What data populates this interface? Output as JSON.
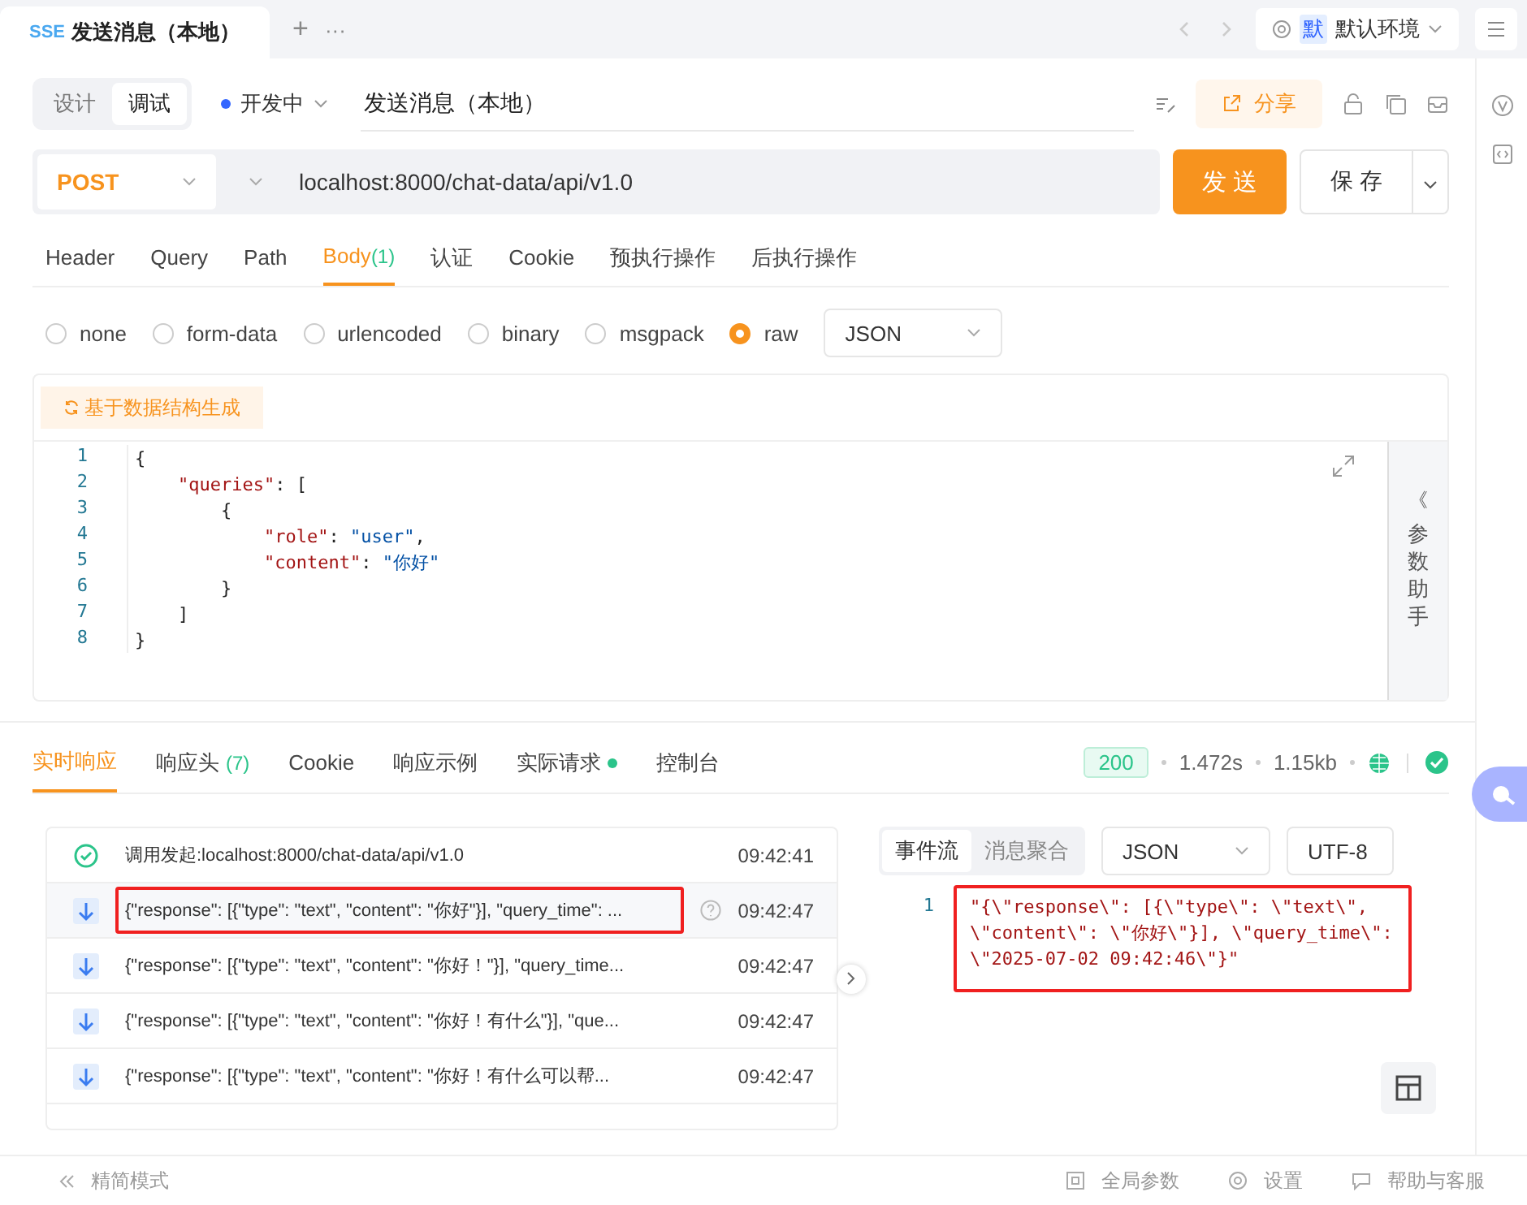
{
  "tab_bar": {
    "tabs": [
      {
        "badge": "SSE",
        "label": "发送消息（本地）",
        "selected": true
      }
    ],
    "add": "+",
    "more": "···",
    "environment": {
      "badge": "默",
      "label": "默认环境"
    }
  },
  "toolbar": {
    "modes": [
      {
        "label": "设计",
        "selected": false
      },
      {
        "label": "调试",
        "selected": true
      }
    ],
    "status": {
      "label": "开发中",
      "color": "#3366ff"
    },
    "name": "发送消息（本地）",
    "share": "分享"
  },
  "request": {
    "method": "POST",
    "url": "localhost:8000/chat-data/api/v1.0",
    "send": "发 送",
    "save": "保 存"
  },
  "param_tabs": [
    {
      "label": "Header",
      "selected": false
    },
    {
      "label": "Query",
      "selected": false
    },
    {
      "label": "Path",
      "selected": false
    },
    {
      "label": "Body",
      "count": "(1)",
      "selected": true
    },
    {
      "label": "认证",
      "selected": false
    },
    {
      "label": "Cookie",
      "selected": false
    },
    {
      "label": "预执行操作",
      "selected": false
    },
    {
      "label": "后执行操作",
      "selected": false
    }
  ],
  "body_types": [
    {
      "label": "none",
      "selected": false
    },
    {
      "label": "form-data",
      "selected": false
    },
    {
      "label": "urlencoded",
      "selected": false
    },
    {
      "label": "binary",
      "selected": false
    },
    {
      "label": "msgpack",
      "selected": false
    },
    {
      "label": "raw",
      "selected": true
    }
  ],
  "body_format": "JSON",
  "generate_button": "基于数据结构生成",
  "editor": {
    "lines": [
      {
        "number": "1",
        "tokens": [
          {
            "kind": "punct",
            "text": "{"
          }
        ]
      },
      {
        "number": "2",
        "tokens": [
          {
            "kind": "key",
            "text": "    \"queries\""
          },
          {
            "kind": "punct",
            "text": ": ["
          }
        ]
      },
      {
        "number": "3",
        "tokens": [
          {
            "kind": "punct",
            "text": "        {"
          }
        ]
      },
      {
        "number": "4",
        "tokens": [
          {
            "kind": "key",
            "text": "            \"role\""
          },
          {
            "kind": "punct",
            "text": ": "
          },
          {
            "kind": "str",
            "text": "\"user\""
          },
          {
            "kind": "punct",
            "text": ","
          }
        ]
      },
      {
        "number": "5",
        "tokens": [
          {
            "kind": "key",
            "text": "            \"content\""
          },
          {
            "kind": "punct",
            "text": ": "
          },
          {
            "kind": "str",
            "text": "\"你好\""
          }
        ]
      },
      {
        "number": "6",
        "tokens": [
          {
            "kind": "punct",
            "text": "        }"
          }
        ]
      },
      {
        "number": "7",
        "tokens": [
          {
            "kind": "punct",
            "text": "    ]"
          }
        ]
      },
      {
        "number": "8",
        "tokens": [
          {
            "kind": "punct",
            "text": "}"
          }
        ]
      }
    ]
  },
  "helper": {
    "icon": "《",
    "label": "参数助手"
  },
  "response": {
    "tabs": [
      {
        "label": "实时响应",
        "selected": true
      },
      {
        "label": "响应头",
        "count": "(7)",
        "selected": false
      },
      {
        "label": "Cookie",
        "selected": false
      },
      {
        "label": "响应示例",
        "selected": false
      },
      {
        "label": "实际请求",
        "dot": true,
        "selected": false
      },
      {
        "label": "控制台",
        "selected": false
      }
    ],
    "status_code": "200",
    "time": "1.472s",
    "size": "1.15kb"
  },
  "events": [
    {
      "kind": "start",
      "text": "调用发起:localhost:8000/chat-data/api/v1.0",
      "time": "09:42:41",
      "selected": false,
      "highlighted": false
    },
    {
      "kind": "message",
      "text": "{\"response\": [{\"type\": \"text\", \"content\": \"你好\"}], \"query_time\": ...",
      "time": "09:42:47",
      "selected": true,
      "highlighted": true
    },
    {
      "kind": "message",
      "text": "{\"response\": [{\"type\": \"text\", \"content\": \"你好！\"}], \"query_time...",
      "time": "09:42:47",
      "selected": false,
      "highlighted": false
    },
    {
      "kind": "message",
      "text": "{\"response\": [{\"type\": \"text\", \"content\": \"你好！有什么\"}], \"que...",
      "time": "09:42:47",
      "selected": false,
      "highlighted": false
    },
    {
      "kind": "message",
      "text": "{\"response\": [{\"type\": \"text\", \"content\": \"你好！有什么可以帮...",
      "time": "09:42:47",
      "selected": false,
      "highlighted": false
    }
  ],
  "viewer": {
    "modes": [
      {
        "label": "事件流",
        "selected": true
      },
      {
        "label": "消息聚合",
        "selected": false
      }
    ],
    "format": "JSON",
    "encoding": "UTF-8",
    "line_number": "1",
    "code": "\"{\\\"response\\\": [{\\\"type\\\": \\\"text\\\", \\\"content\\\": \\\"你好\\\"}], \\\"query_time\\\": \\\"2025-07-02 09:42:46\\\"}\"",
    "highlighted": true
  },
  "footer": {
    "compact": "精简模式",
    "items": [
      {
        "kind": "global",
        "label": "全局参数"
      },
      {
        "kind": "settings",
        "label": "设置"
      },
      {
        "kind": "help",
        "label": "帮助与客服"
      }
    ]
  }
}
